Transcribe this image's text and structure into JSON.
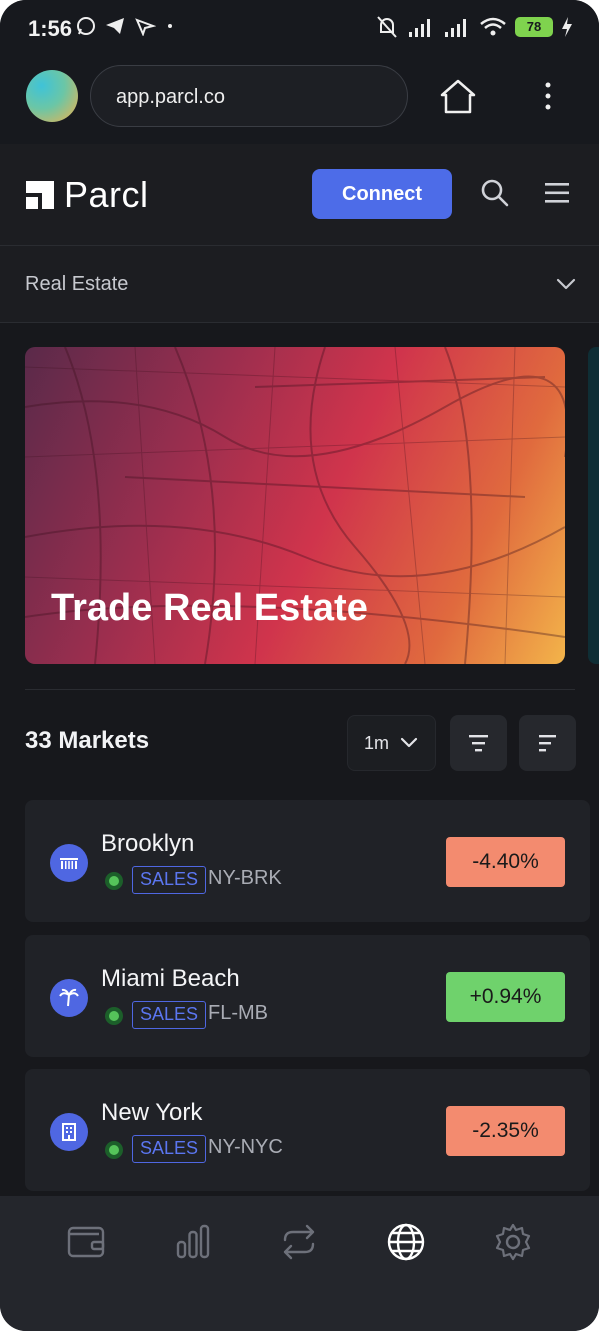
{
  "status_bar": {
    "time": "1:56",
    "battery": "78",
    "icons": [
      "whatsapp-icon",
      "telegram-icon",
      "location-off-icon",
      "dot-icon",
      "mute-icon",
      "signal-icon",
      "signal-icon",
      "wifi-icon",
      "battery-icon",
      "charging-icon"
    ]
  },
  "browser": {
    "url": "app.parcl.co",
    "home_icon": "home-icon",
    "menu_icon": "kebab-icon"
  },
  "header": {
    "logo_text": "Parcl",
    "connect_label": "Connect",
    "search_icon": "search-icon",
    "menu_icon": "hamburger-icon"
  },
  "category": {
    "selected": "Real Estate"
  },
  "banner": {
    "title": "Trade Real Estate"
  },
  "markets": {
    "count_label": "33 Markets",
    "period": "1m",
    "items": [
      {
        "name": "Brooklyn",
        "badge": "SALES",
        "code": "NY-BRK",
        "change": "-4.40%",
        "direction": "down",
        "icon": "bridge-icon"
      },
      {
        "name": "Miami Beach",
        "badge": "SALES",
        "code": "FL-MB",
        "change": "+0.94%",
        "direction": "up",
        "icon": "palm-tree-icon"
      },
      {
        "name": "New York",
        "badge": "SALES",
        "code": "NY-NYC",
        "change": "-2.35%",
        "direction": "down",
        "icon": "building-icon"
      }
    ]
  },
  "bottom_nav": {
    "items": [
      "wallet-icon",
      "chart-bars-icon",
      "swap-icon",
      "globe-icon",
      "settings-icon"
    ],
    "active": "globe-icon"
  },
  "colors": {
    "accent": "#4d6ce8",
    "negative": "#f38b6f",
    "positive": "#6fd26c",
    "background": "#17191e"
  }
}
